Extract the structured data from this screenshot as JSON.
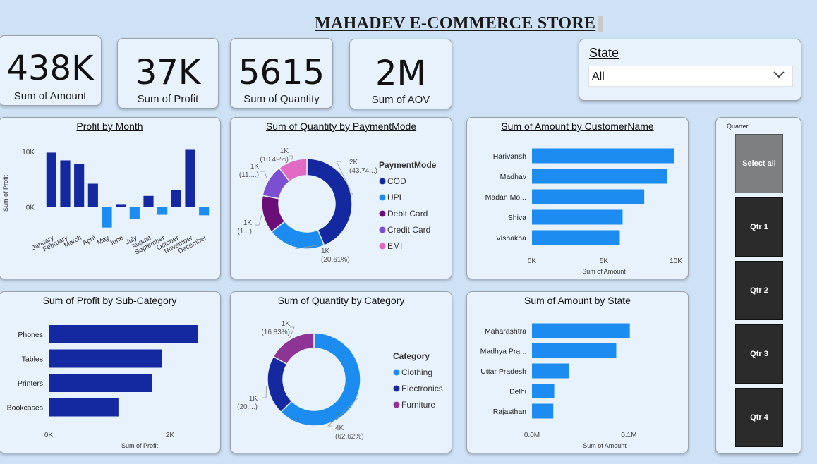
{
  "header": {
    "title": "MAHADEV E-COMMERCE STORE"
  },
  "kpis": [
    {
      "value": "438K",
      "label": "Sum of Amount"
    },
    {
      "value": "37K",
      "label": "Sum of Profit"
    },
    {
      "value": "5615",
      "label": "Sum of Quantity"
    },
    {
      "value": "2M",
      "label": "Sum of AOV"
    }
  ],
  "state_filter": {
    "label": "State",
    "selected": "All"
  },
  "quarter_slicer": {
    "label": "Quarter",
    "options": [
      "Select all",
      "Qtr 1",
      "Qtr 2",
      "Qtr 3",
      "Qtr 4"
    ],
    "selected": "Select all"
  },
  "colors": {
    "navy": "#1428a0",
    "blue": "#1c8cf0",
    "purple": "#6b0f78",
    "violet": "#7b4fcf",
    "pink": "#e06ac4",
    "magenta": "#8e3494"
  },
  "chart_data": [
    {
      "id": "profit_by_month",
      "type": "bar",
      "title": "Profit by Month",
      "ylabel": "Sum of Profit",
      "yticks": [
        "10K",
        "0K"
      ],
      "categories": [
        "January",
        "February",
        "March",
        "April",
        "May",
        "June",
        "July",
        "August",
        "September",
        "October",
        "November",
        "December"
      ],
      "values": [
        9800,
        8400,
        7800,
        4200,
        -3700,
        400,
        -2200,
        2000,
        -1400,
        3000,
        10300,
        -1500
      ],
      "ylim": [
        -4000,
        11000
      ]
    },
    {
      "id": "quantity_by_paymentmode",
      "type": "pie",
      "title": "Sum of Quantity by PaymentMode",
      "legend_title": "PaymentMode",
      "labels": [
        "COD",
        "UPI",
        "Debit Card",
        "Credit Card",
        "EMI"
      ],
      "values": [
        43.74,
        20.61,
        13.6,
        11.6,
        10.49
      ],
      "data_labels": [
        [
          "2K",
          "(43.74...)"
        ],
        [
          "1K",
          "(20.61%)"
        ],
        [
          "1K",
          "(1...)"
        ],
        [
          "1K",
          "(11....)"
        ],
        [
          "1K",
          "(10.49%)"
        ]
      ]
    },
    {
      "id": "amount_by_customer",
      "type": "bar",
      "title": "Sum of Amount by CustomerName",
      "xlabel": "Sum of Amount",
      "xticks": [
        "0K",
        "5K",
        "10K"
      ],
      "categories": [
        "Harivansh",
        "Madhav",
        "Madan Mo...",
        "Shiva",
        "Vishakha"
      ],
      "values": [
        9900,
        9400,
        7800,
        6300,
        6100
      ],
      "xlim": [
        0,
        10000
      ]
    },
    {
      "id": "profit_by_subcategory",
      "type": "bar",
      "title": "Sum of Profit by Sub-Category",
      "xlabel": "Sum of Profit",
      "xticks": [
        "0K",
        "2K"
      ],
      "categories": [
        "Phones",
        "Tables",
        "Printers",
        "Bookcases"
      ],
      "values": [
        2460,
        1870,
        1700,
        1150
      ],
      "xlim": [
        0,
        3000
      ]
    },
    {
      "id": "quantity_by_category",
      "type": "pie",
      "title": "Sum of Quantity by Category",
      "legend_title": "Category",
      "labels": [
        "Clothing",
        "Electronics",
        "Furniture"
      ],
      "values": [
        62.62,
        20.55,
        16.83
      ],
      "data_labels": [
        [
          "4K",
          "(62.62%)"
        ],
        [
          "1K",
          "(20....)"
        ],
        [
          "1K",
          "(16.83%)"
        ]
      ]
    },
    {
      "id": "amount_by_state",
      "type": "bar",
      "title": "Sum of Amount by State",
      "xlabel": "Sum of Amount",
      "xticks": [
        "0.0M",
        "0.1M"
      ],
      "categories": [
        "Maharashtra",
        "Madhya Pra...",
        "Uttar Pradesh",
        "Delhi",
        "Rajasthan"
      ],
      "values": [
        0.101,
        0.087,
        0.038,
        0.023,
        0.022
      ],
      "xlim": [
        0,
        0.15
      ]
    }
  ]
}
